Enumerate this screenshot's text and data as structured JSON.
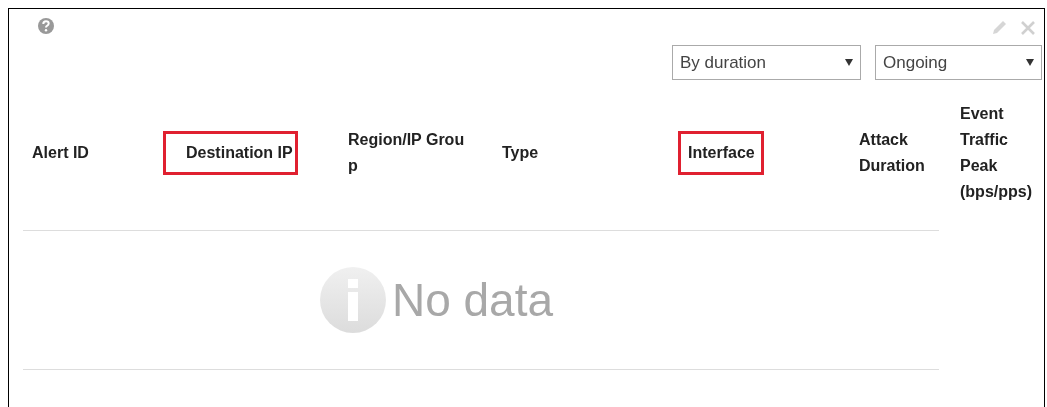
{
  "filters": [
    {
      "value": "By duration"
    },
    {
      "value": "Ongoing"
    }
  ],
  "table": {
    "columns": [
      {
        "label": "Alert ID",
        "highlighted": false
      },
      {
        "label": "Destination IP",
        "highlighted": true
      },
      {
        "label": "Region/IP Group",
        "highlighted": false
      },
      {
        "label": "Type",
        "highlighted": false
      },
      {
        "label": "Interface",
        "highlighted": true
      },
      {
        "label": "Attack Duration",
        "highlighted": false
      },
      {
        "label": "Event Traffic Peak (bps/pps)",
        "highlighted": false
      }
    ],
    "empty_message": "No data"
  }
}
